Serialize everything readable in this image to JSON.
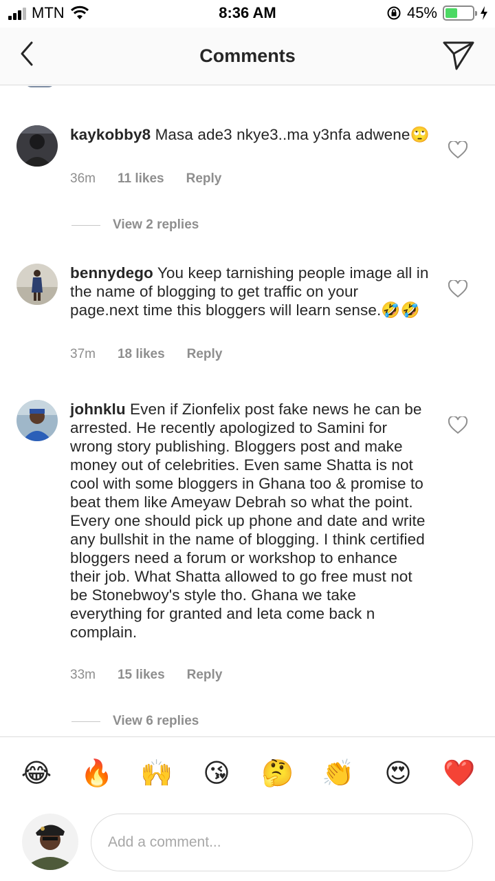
{
  "status_bar": {
    "carrier": "MTN",
    "time": "8:36 AM",
    "battery_percent": "45%",
    "battery_level": 0.45
  },
  "nav": {
    "title": "Comments"
  },
  "comments": [
    {
      "username": "kaykobby8",
      "text": " Masa ade3 nkye3..ma y3nfa adwene🙄",
      "time": "36m",
      "likes": "11 likes",
      "reply": "Reply",
      "view_replies": "View 2 replies"
    },
    {
      "username": "bennydego",
      "text": " You keep tarnishing people image all in the name of blogging to get traffic on your page.next time this bloggers will learn sense.🤣🤣",
      "time": "37m",
      "likes": "18 likes",
      "reply": "Reply"
    },
    {
      "username": "johnklu",
      "text": " Even if Zionfelix post fake news he can be arrested. He recently apologized to Samini for wrong story publishing.  Bloggers post and make money out of celebrities. Even same Shatta is not cool with some bloggers in Ghana too & promise to beat them like Ameyaw Debrah so what the point. Every one should pick up phone and date and write any bullshit in the name of blogging. I think certified bloggers need a forum or workshop to enhance their job. What Shatta allowed to go free must not be Stonebwoy's style tho. Ghana we take everything for granted and leta come back n complain.",
      "time": "33m",
      "likes": "15 likes",
      "reply": "Reply",
      "view_replies": "View 6 replies"
    }
  ],
  "emoji_bar": [
    "😂",
    "🔥",
    "🙌",
    "😘",
    "🤔",
    "👏",
    "😍",
    "❤️"
  ],
  "composer": {
    "placeholder": "Add a comment..."
  },
  "colors": {
    "text": "#262626",
    "muted": "#8e8e8e",
    "divider": "#dbdbdb",
    "battery": "#4cd964"
  }
}
